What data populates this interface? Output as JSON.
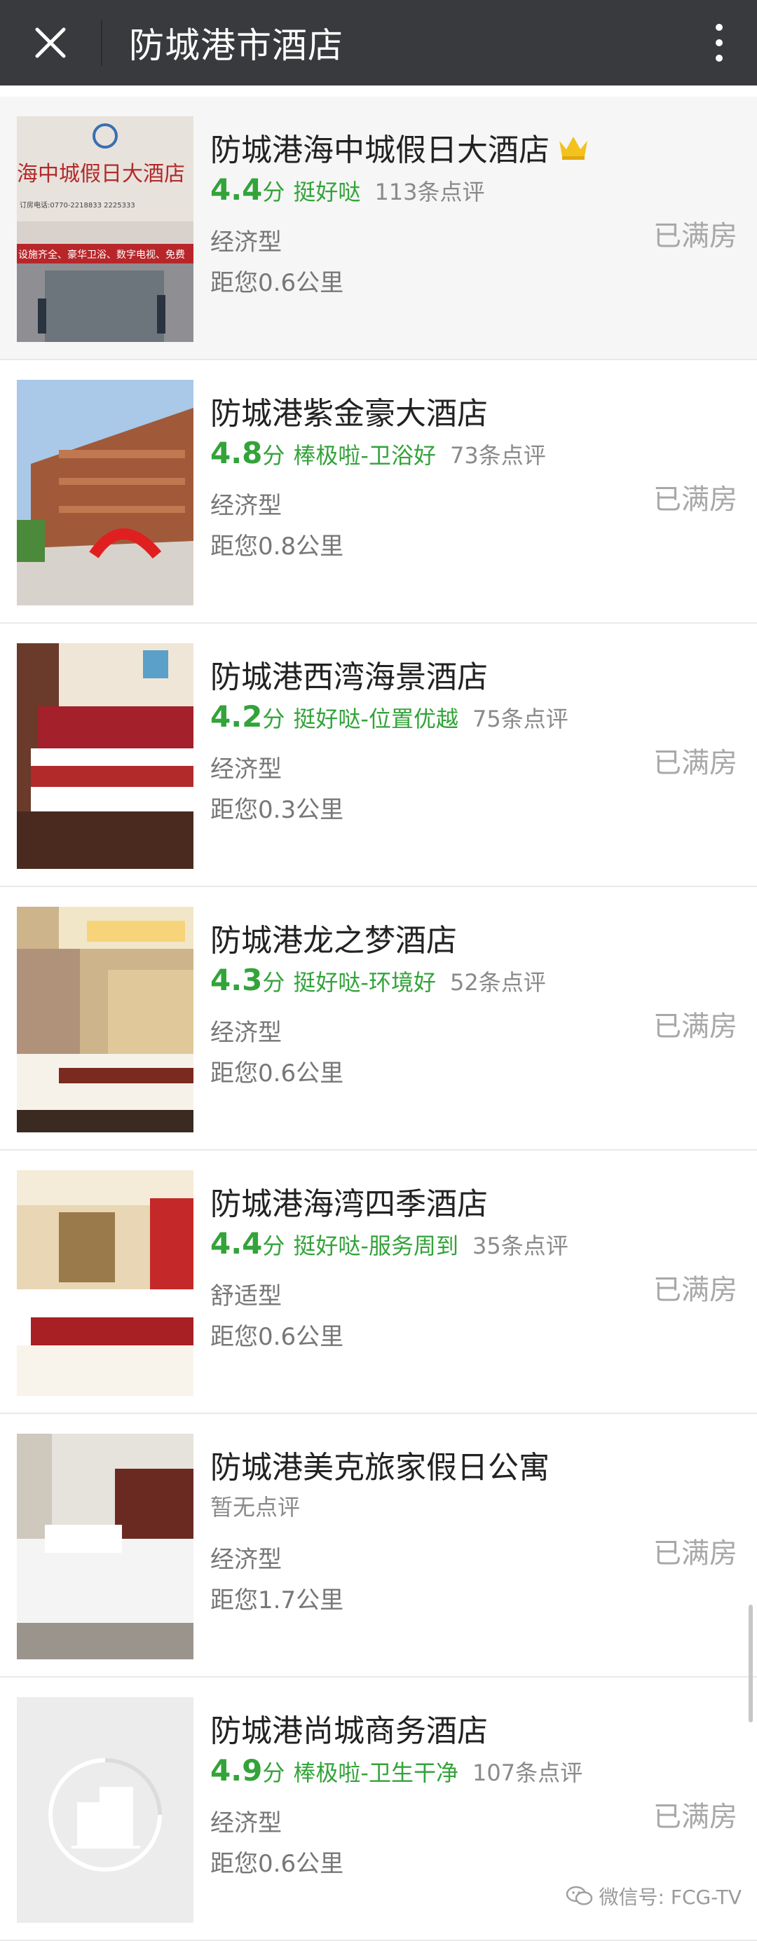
{
  "header": {
    "title": "防城港市酒店"
  },
  "icons": {
    "close": "close-icon",
    "more": "more-vertical-icon",
    "crown": "crown-icon",
    "wechat": "wechat-icon"
  },
  "colors": {
    "topbar": "#393a3e",
    "rating_green": "#33a33a",
    "status_gray": "#a8a8a8",
    "crown_gold": "#f3c21c"
  },
  "hotels": [
    {
      "name": "防城港海中城假日大酒店",
      "score": "4.4",
      "score_unit": "分",
      "tag": "挺好哒",
      "reviews": "113条点评",
      "type": "经济型",
      "distance": "距您0.6公里",
      "status": "已满房",
      "sign_text": "海中城假日大酒店",
      "sign_phone": "订房电话:0770-2218833  2225333",
      "sign_banner": "设施齐全、豪华卫浴、数字电视、免费"
    },
    {
      "name": "防城港紫金豪大酒店",
      "score": "4.8",
      "score_unit": "分",
      "tag": "棒极啦-卫浴好",
      "reviews": "73条点评",
      "type": "经济型",
      "distance": "距您0.8公里",
      "status": "已满房"
    },
    {
      "name": "防城港西湾海景酒店",
      "score": "4.2",
      "score_unit": "分",
      "tag": "挺好哒-位置优越",
      "reviews": "75条点评",
      "type": "经济型",
      "distance": "距您0.3公里",
      "status": "已满房"
    },
    {
      "name": "防城港龙之梦酒店",
      "score": "4.3",
      "score_unit": "分",
      "tag": "挺好哒-环境好",
      "reviews": "52条点评",
      "type": "经济型",
      "distance": "距您0.6公里",
      "status": "已满房"
    },
    {
      "name": "防城港海湾四季酒店",
      "score": "4.4",
      "score_unit": "分",
      "tag": "挺好哒-服务周到",
      "reviews": "35条点评",
      "type": "舒适型",
      "distance": "距您0.6公里",
      "status": "已满房"
    },
    {
      "name": "防城港美克旅家假日公寓",
      "no_review": "暂无点评",
      "type": "经济型",
      "distance": "距您1.7公里",
      "status": "已满房"
    },
    {
      "name": "防城港尚城商务酒店",
      "score": "4.9",
      "score_unit": "分",
      "tag": "棒极啦-卫生干净",
      "reviews": "107条点评",
      "type": "经济型",
      "distance": "距您0.6公里",
      "status": "已满房"
    }
  ],
  "watermark": {
    "text": "微信号: FCG-TV"
  }
}
